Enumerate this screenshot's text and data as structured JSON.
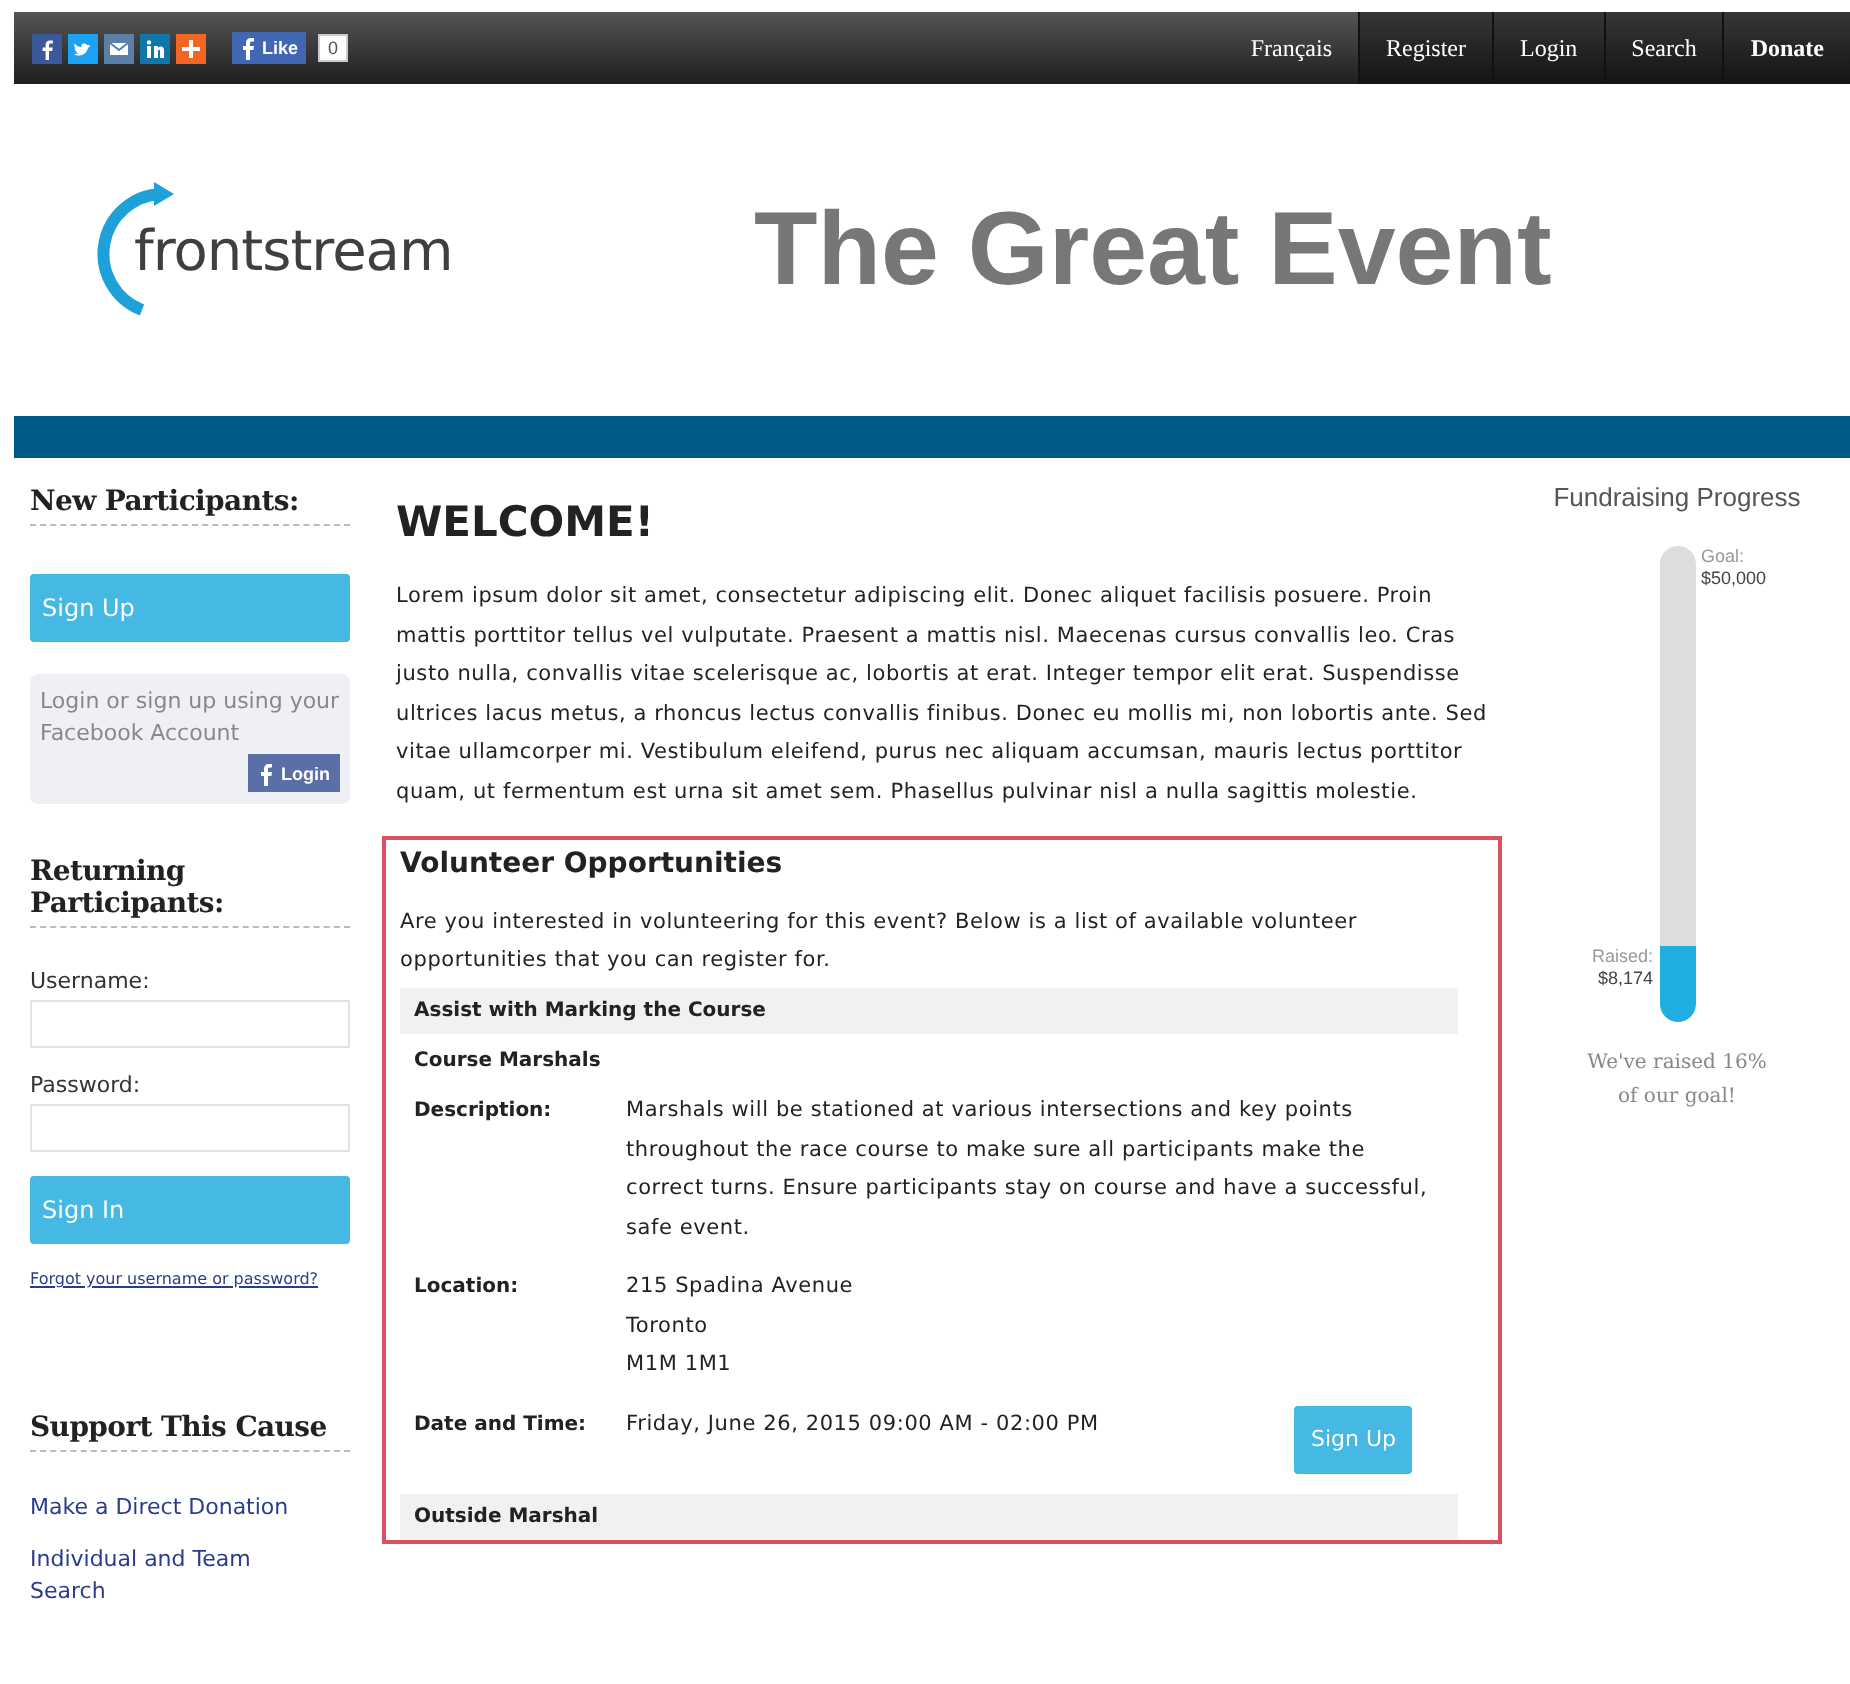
{
  "top_bar": {
    "share_icons": [
      {
        "kind": "facebook"
      },
      {
        "kind": "twitter"
      },
      {
        "kind": "email"
      },
      {
        "kind": "linkedin"
      },
      {
        "kind": "plus"
      }
    ],
    "like_button": {
      "label": "Like",
      "count": "0"
    },
    "nav": [
      {
        "label": "Français",
        "kind": "language",
        "bold": false
      },
      {
        "label": "Register",
        "kind": "link",
        "bold": false
      },
      {
        "label": "Login",
        "kind": "link",
        "bold": false
      },
      {
        "label": "Search",
        "kind": "link",
        "bold": false
      },
      {
        "label": "Donate",
        "kind": "link",
        "bold": true
      }
    ]
  },
  "header": {
    "logo": "frontstream",
    "title": "The Great Event"
  },
  "sidebar": {
    "new_heading": "New Participants:",
    "signup_button": "Sign Up",
    "facebook_text": "Login or sign up using your Facebook Account",
    "facebook_button": "Login",
    "returning_heading": "Returning Participants:",
    "fields": [
      {
        "label": "Username:"
      },
      {
        "label": "Password:"
      }
    ],
    "signin_button": "Sign In",
    "forgot_link": "Forgot your username or password?",
    "support_heading": "Support This Cause",
    "links": [
      "Make a Direct Donation",
      "Individual and Team Search"
    ]
  },
  "main": {
    "heading": "WELCOME!",
    "intro": "Lorem ipsum dolor sit amet, consectetur adipiscing elit. Donec aliquet facilisis posuere. Proin mattis porttitor tellus vel vulputate. Praesent a mattis nisl. Maecenas cursus convallis leo. Cras justo nulla, convallis vitae scelerisque ac, lobortis at erat. Integer tempor elit erat. Suspendisse ultrices lacus metus, a rhoncus lectus convallis finibus. Donec eu mollis mi, non lobortis ante. Sed vitae ullamcorper mi. Vestibulum eleifend, purus nec aliquam accumsan, mauris lectus porttitor quam, ut fermentum est urna sit amet sem. Phasellus pulvinar nisl a nulla sagittis molestie.",
    "volunteer": {
      "heading": "Volunteer Opportunities",
      "intro": "Are you interested in volunteering for this event? Below is a list of available volunteer opportunities that you can register for.",
      "groups": [
        {
          "title": "Assist with Marking the Course",
          "roles": [
            {
              "name": "Course Marshals",
              "details": [
                {
                  "label": "Description:",
                  "lines": [
                    "Marshals will be stationed at various intersections and key points throughout the race course to make sure all participants make the correct turns. Ensure participants stay on course and have a successful, safe event."
                  ]
                },
                {
                  "label": "Location:",
                  "lines": [
                    "215 Spadina Avenue",
                    "Toronto",
                    "M1M 1M1"
                  ]
                },
                {
                  "label": "Date and Time:",
                  "lines": [
                    "Friday, June 26, 2015 09:00 AM - 02:00 PM"
                  ]
                }
              ],
              "button": "Sign Up"
            }
          ]
        },
        {
          "title": "Outside Marshal"
        }
      ]
    }
  },
  "progress": {
    "heading": "Fundraising Progress",
    "goal_label": "Goal:",
    "goal": "$50,000",
    "raised_label": "Raised:",
    "raised": "$8,174",
    "level": 0.16,
    "caption": "We've raised 16% of our goal!"
  }
}
